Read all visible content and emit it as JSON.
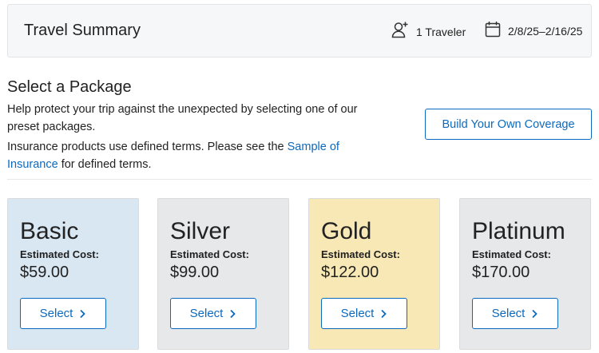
{
  "summary": {
    "title": "Travel Summary",
    "travelers": "1 Traveler",
    "dates": "2/8/25–2/16/25",
    "travelers_icon": "add-person-icon",
    "dates_icon": "calendar-icon"
  },
  "packages_section": {
    "heading": "Select a Package",
    "help_text": "Help protect your trip against the unexpected by selecting one of our preset packages.",
    "terms_prefix": "Insurance products use defined terms. Please see the ",
    "terms_link": "Sample of Insurance",
    "terms_suffix": " for defined terms.",
    "build_button": "Build Your Own Coverage"
  },
  "packages": [
    {
      "name": "Basic",
      "estimated_label": "Estimated Cost:",
      "price": "$59.00",
      "select_label": "Select",
      "color": "#d9e7f3"
    },
    {
      "name": "Silver",
      "estimated_label": "Estimated Cost:",
      "price": "$99.00",
      "select_label": "Select",
      "color": "#e6e8ea"
    },
    {
      "name": "Gold",
      "estimated_label": "Estimated Cost:",
      "price": "$122.00",
      "select_label": "Select",
      "color": "#f8e8b6"
    },
    {
      "name": "Platinum",
      "estimated_label": "Estimated Cost:",
      "price": "$170.00",
      "select_label": "Select",
      "color": "#e6e8ea"
    }
  ],
  "colors": {
    "accent": "#0b6abf",
    "summary_bg": "#f6f7f8"
  }
}
